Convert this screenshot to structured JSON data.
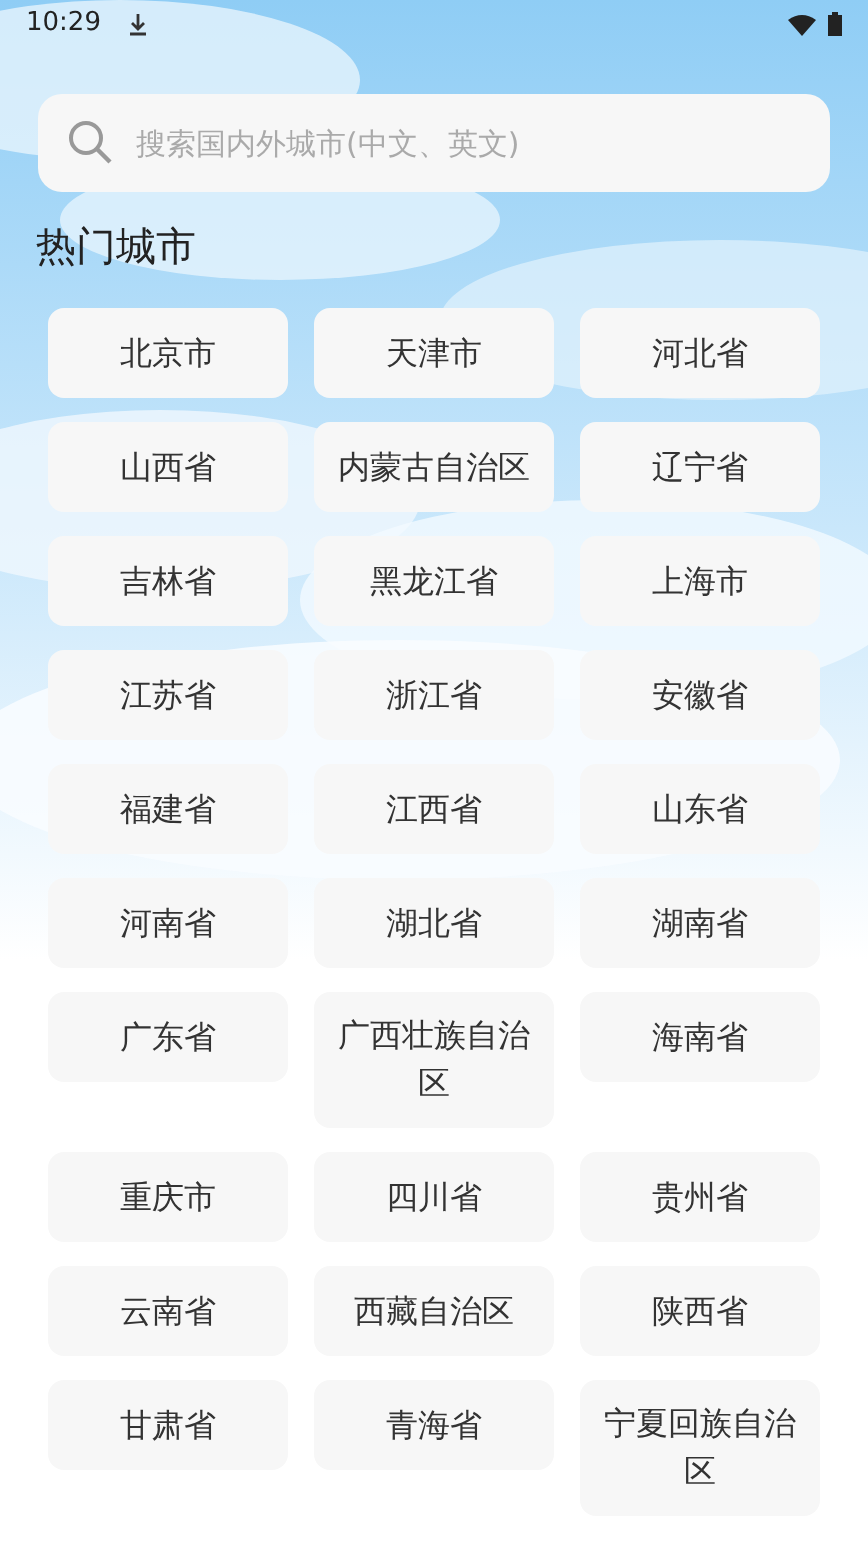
{
  "status_bar": {
    "time": "10:29"
  },
  "search": {
    "placeholder": "搜索国内外城市(中文、英文)"
  },
  "section_title": "热门城市",
  "cities": [
    "北京市",
    "天津市",
    "河北省",
    "山西省",
    "内蒙古自治区",
    "辽宁省",
    "吉林省",
    "黑龙江省",
    "上海市",
    "江苏省",
    "浙江省",
    "安徽省",
    "福建省",
    "江西省",
    "山东省",
    "河南省",
    "湖北省",
    "湖南省",
    "广东省",
    "广西壮族自治区",
    "海南省",
    "重庆市",
    "四川省",
    "贵州省",
    "云南省",
    "西藏自治区",
    "陕西省",
    "甘肃省",
    "青海省",
    "宁夏回族自治区"
  ]
}
